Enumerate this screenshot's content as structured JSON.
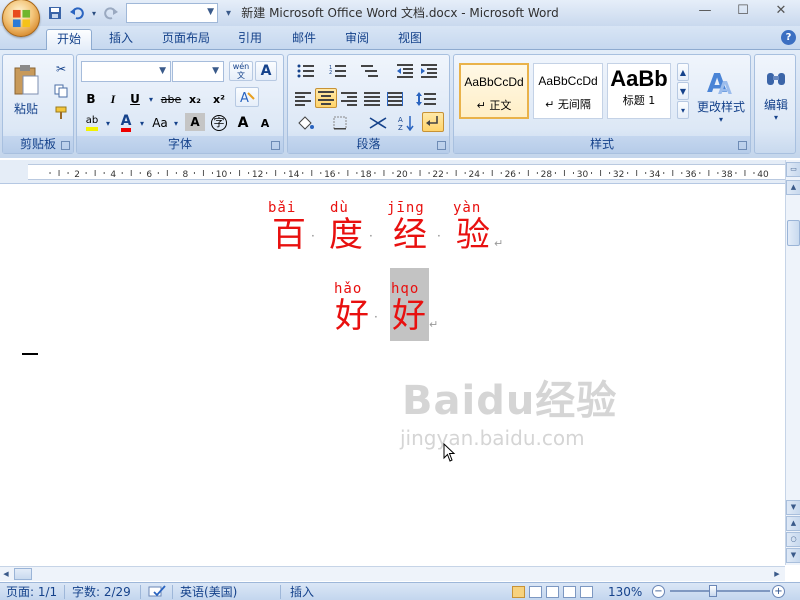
{
  "titlebar": {
    "title": "新建 Microsoft Office Word 文档.docx - Microsoft Word",
    "minimize": "—",
    "maximize": "☐",
    "close": "✕"
  },
  "qat": {
    "save": "save-icon",
    "undo": "undo-icon",
    "redo": "redo-icon"
  },
  "tabs": [
    "开始",
    "插入",
    "页面布局",
    "引用",
    "邮件",
    "审阅",
    "视图"
  ],
  "help": "?",
  "ribbon": {
    "clipboard": {
      "label": "剪贴板",
      "paste": "粘贴"
    },
    "font": {
      "label": "字体",
      "font_name": "",
      "font_size": "",
      "wen": "wén\n文",
      "A_box": "A",
      "bold": "B",
      "italic": "I",
      "underline": "U",
      "strike": "abe",
      "subscript": "x₂",
      "superscript": "x²",
      "highlight": "ab",
      "font_color": "A",
      "change_case": "Aa",
      "char_shade": "A",
      "enclose": "字",
      "grow": "A",
      "shrink": "A"
    },
    "paragraph": {
      "label": "段落"
    },
    "styles": {
      "label": "样式",
      "items": [
        {
          "preview": "AaBbCcDd",
          "name": "↵ 正文"
        },
        {
          "preview": "AaBbCcDd",
          "name": "↵ 无间隔"
        },
        {
          "preview": "AaBb",
          "name": "标题 1"
        }
      ],
      "change_styles": "更改样式"
    },
    "editing": {
      "label": "编辑"
    }
  },
  "ruler": {
    "numbers": [
      "2",
      "4",
      "6",
      "8",
      "10",
      "12",
      "14",
      "16",
      "18",
      "20",
      "22",
      "24",
      "26",
      "28",
      "30",
      "32",
      "34",
      "36",
      "38",
      "40"
    ]
  },
  "document": {
    "line1": [
      {
        "char": "百",
        "pinyin": "bǎi"
      },
      {
        "char": "度",
        "pinyin": "dù"
      },
      {
        "char": "经",
        "pinyin": "jīng"
      },
      {
        "char": "验",
        "pinyin": "yàn"
      }
    ],
    "line2": [
      {
        "char": "好",
        "pinyin": "hǎo"
      },
      {
        "char": "好",
        "pinyin": "hqo"
      }
    ],
    "para_mark": "↵",
    "ink_color": "#e8100f",
    "watermark": "Baidu经验",
    "watermark_url": "jingyan.baidu.com"
  },
  "status": {
    "page": "页面: 1/1",
    "words": "字数: 2/29",
    "language": "英语(美国)",
    "mode": "插入",
    "zoom": "130%",
    "zoom_level": 0.43
  }
}
